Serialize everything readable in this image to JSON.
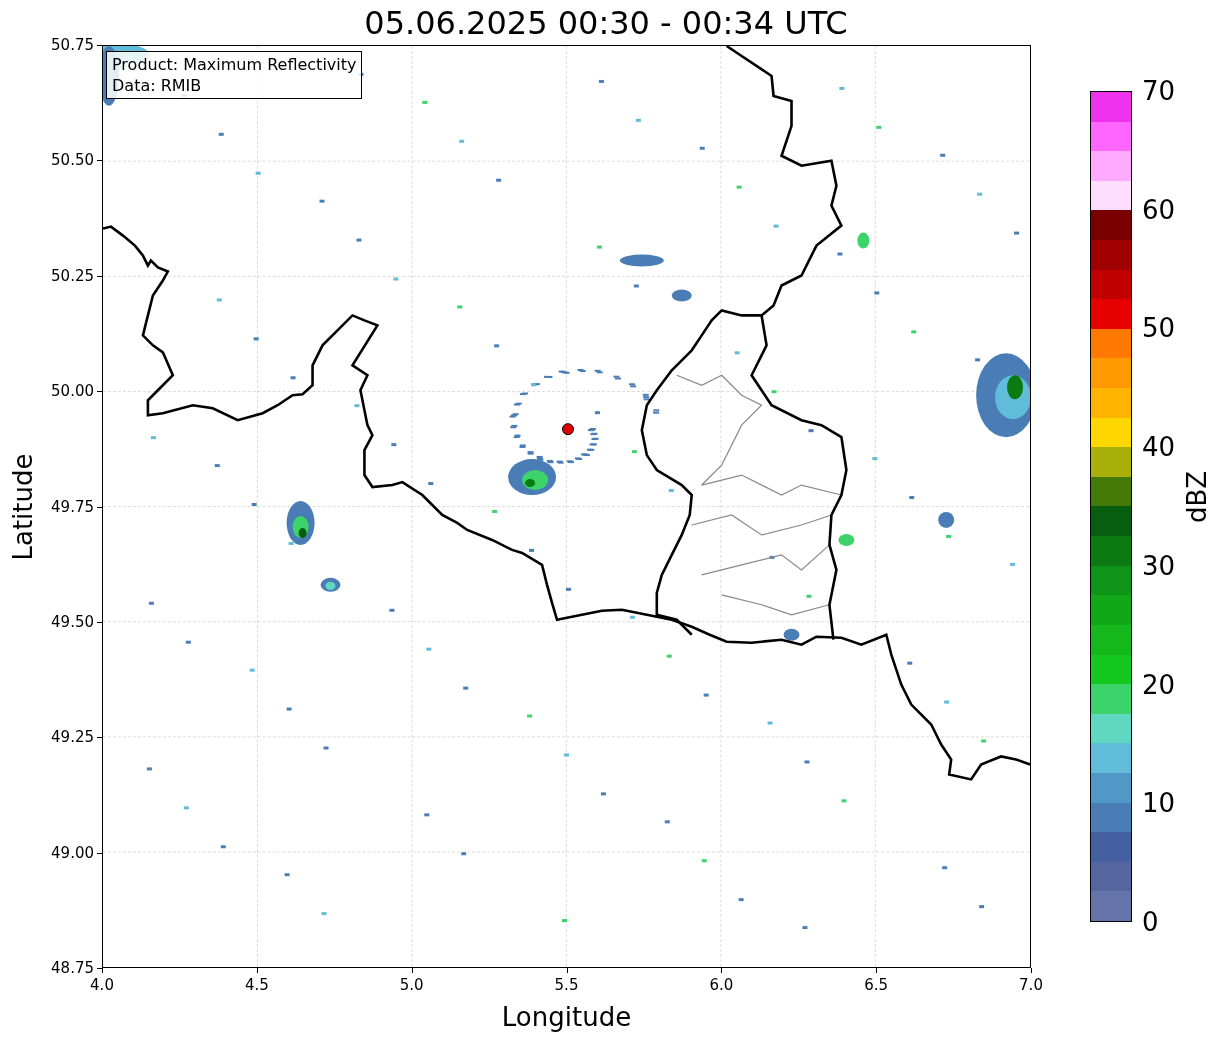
{
  "title": "05.06.2025 00:30 - 00:34 UTC",
  "legend": [
    "Product: Maximum Reflectivity",
    "Data: RMIB"
  ],
  "axes": {
    "xlabel": "Longitude",
    "ylabel": "Latitude",
    "xticks": [
      "4.0",
      "4.5",
      "5.0",
      "5.5",
      "6.0",
      "6.5",
      "7.0"
    ],
    "yticks": [
      "50.75",
      "50.50",
      "50.25",
      "50.00",
      "49.75",
      "49.50",
      "49.25",
      "49.00",
      "48.75"
    ]
  },
  "colorbar": {
    "label": "dBZ",
    "ticks": [
      "70",
      "60",
      "50",
      "40",
      "30",
      "20",
      "10",
      "0"
    ],
    "bins": [
      {
        "color": "#6474a8"
      },
      {
        "color": "#5565a0"
      },
      {
        "color": "#4560a0"
      },
      {
        "color": "#4a7db5"
      },
      {
        "color": "#5098c5"
      },
      {
        "color": "#60bcd8"
      },
      {
        "color": "#60d8c0"
      },
      {
        "color": "#3cd46a"
      },
      {
        "color": "#14c820"
      },
      {
        "color": "#14b81a"
      },
      {
        "color": "#10a818"
      },
      {
        "color": "#0e9416"
      },
      {
        "color": "#0b7a12"
      },
      {
        "color": "#075e0e"
      },
      {
        "color": "#457a08"
      },
      {
        "color": "#aab00a"
      },
      {
        "color": "#ffd700"
      },
      {
        "color": "#ffb400"
      },
      {
        "color": "#ff9900"
      },
      {
        "color": "#ff7800"
      },
      {
        "color": "#e60000"
      },
      {
        "color": "#c00000"
      },
      {
        "color": "#a00000"
      },
      {
        "color": "#7a0000"
      },
      {
        "color": "#ffddff"
      },
      {
        "color": "#ffaaff"
      },
      {
        "color": "#ff66ff"
      },
      {
        "color": "#ee33ee"
      }
    ]
  }
}
